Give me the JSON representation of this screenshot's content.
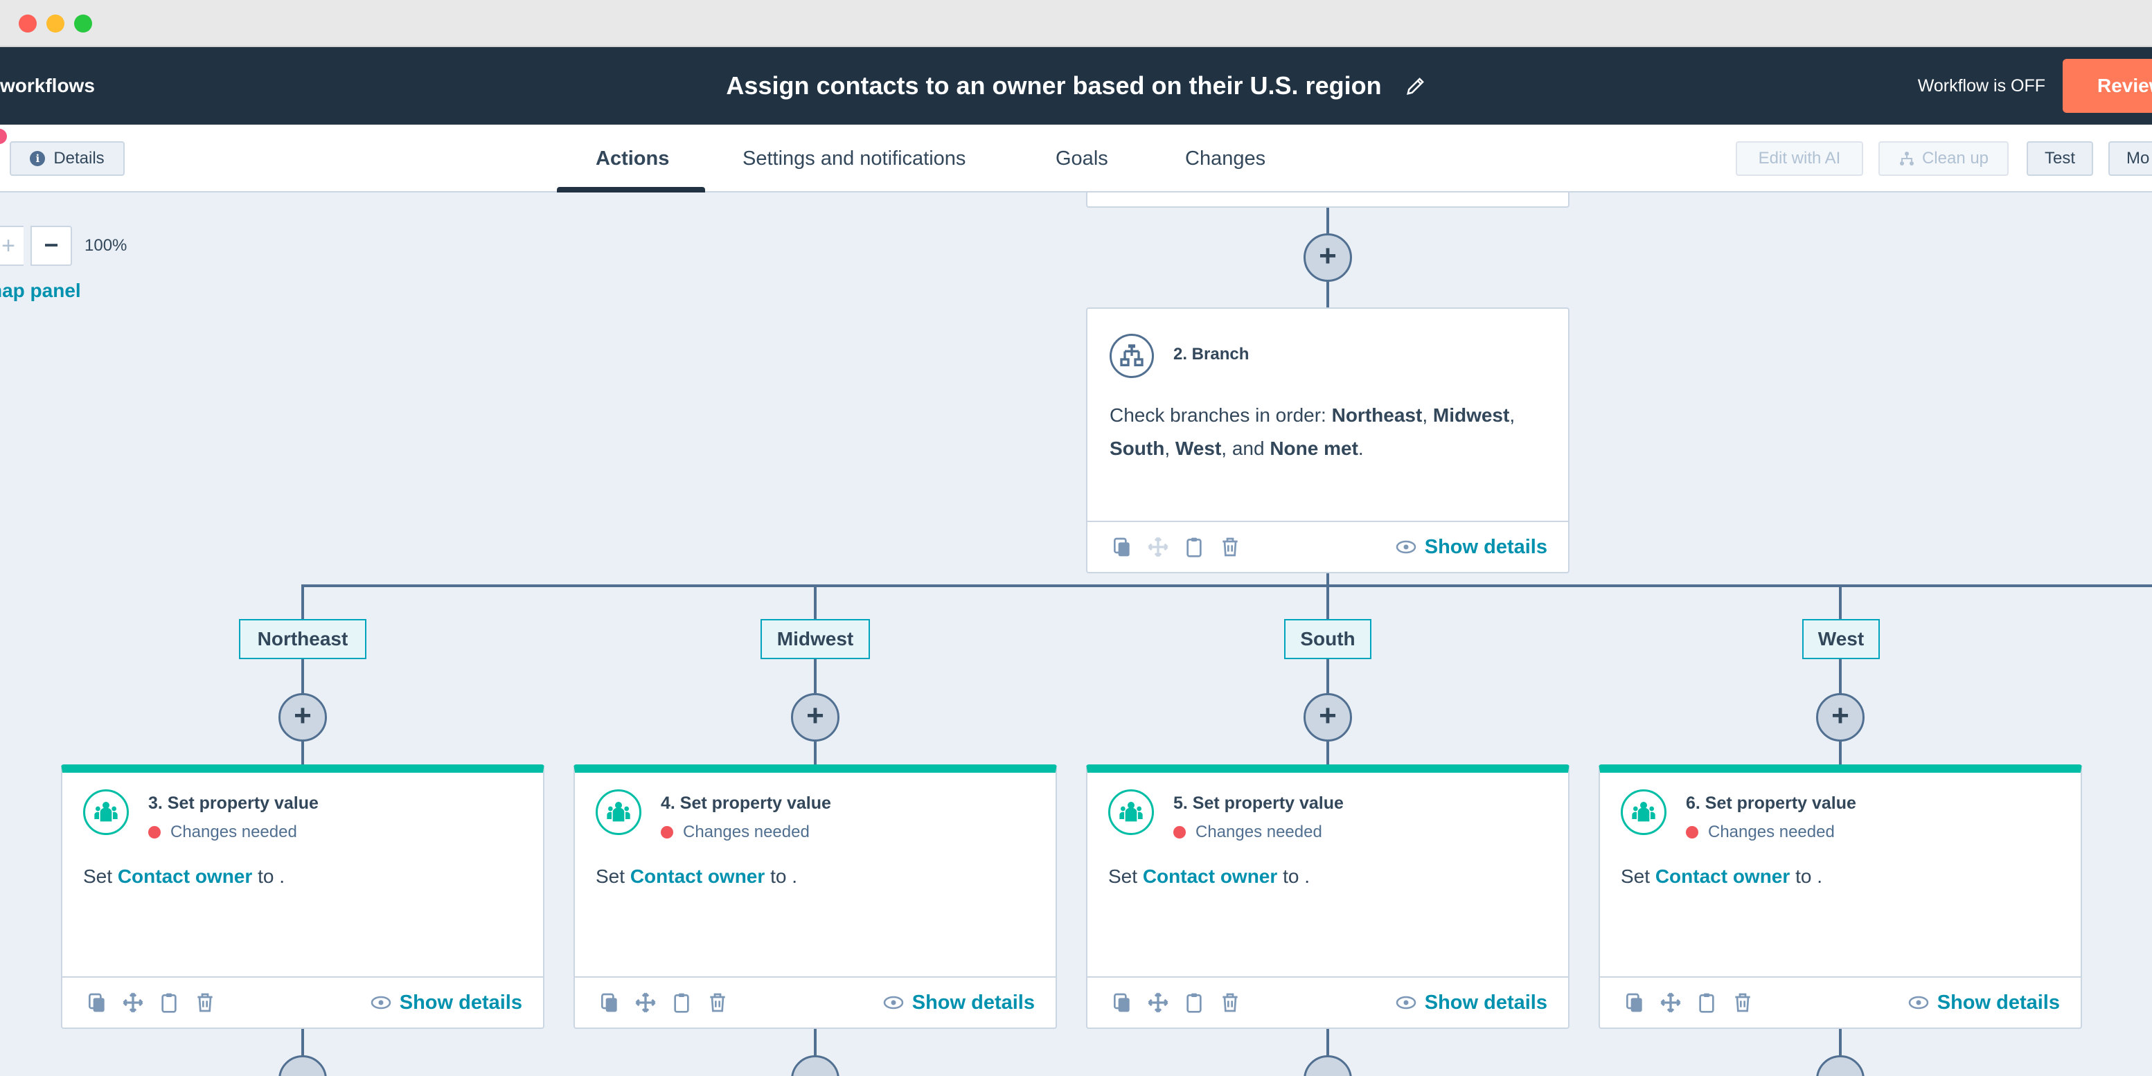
{
  "header": {
    "back_label": "workflows",
    "title": "Assign contacts to an owner based on their U.S. region",
    "status": "Workflow is OFF",
    "review_label": "Review"
  },
  "toolbar": {
    "details_label": "Details",
    "tabs": [
      "Actions",
      "Settings and notifications",
      "Goals",
      "Changes"
    ],
    "active_tab": "Actions",
    "edit_ai_label": "Edit with AI",
    "cleanup_label": "Clean up",
    "test_label": "Test",
    "more_label": "Mo"
  },
  "canvas": {
    "zoom": "100%",
    "map_panel_label": "nap panel",
    "branch": {
      "heading": "2. Branch",
      "desc_prefix": "Check branches in order: ",
      "names": [
        "Northeast",
        "Midwest",
        "South",
        "West"
      ],
      "none_label": "None met",
      "and_label": "and",
      "show_details": "Show details"
    },
    "branch_labels": [
      "Northeast",
      "Midwest",
      "South",
      "West"
    ],
    "actions": [
      {
        "title": "3. Set property value",
        "status": "Changes needed",
        "set": "Set",
        "property": "Contact owner",
        "to": "to .",
        "show_details": "Show details"
      },
      {
        "title": "4. Set property value",
        "status": "Changes needed",
        "set": "Set",
        "property": "Contact owner",
        "to": "to .",
        "show_details": "Show details"
      },
      {
        "title": "5. Set property value",
        "status": "Changes needed",
        "set": "Set",
        "property": "Contact owner",
        "to": "to .",
        "show_details": "Show details"
      },
      {
        "title": "6. Set property value",
        "status": "Changes needed",
        "set": "Set",
        "property": "Contact owner",
        "to": "to .",
        "show_details": "Show details"
      }
    ]
  },
  "colors": {
    "header_bg": "#213343",
    "accent_orange": "#ff7a59",
    "link_teal": "#0091ae",
    "action_green": "#00bda5",
    "error_red": "#f2545b",
    "canvas_bg": "#eaf0f6"
  }
}
